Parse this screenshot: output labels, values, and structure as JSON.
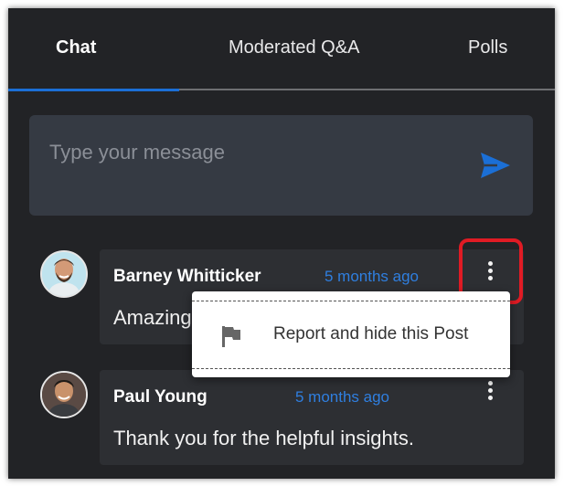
{
  "tabs": [
    {
      "label": "Chat",
      "active": true
    },
    {
      "label": "Moderated Q&A",
      "active": false
    },
    {
      "label": "Polls",
      "active": false
    }
  ],
  "composer": {
    "placeholder": "Type your message",
    "send_icon": "send-icon"
  },
  "messages": [
    {
      "author": "Barney Whitticker",
      "time": "5 months ago",
      "text": "Amazing",
      "more_icon": "more-vertical-icon"
    },
    {
      "author": "Paul Young",
      "time": "5 months ago",
      "text": "Thank you for the helpful insights.",
      "more_icon": "more-vertical-icon"
    }
  ],
  "context_menu": {
    "items": [
      {
        "label": "Report and hide this Post",
        "icon": "flag-icon"
      }
    ]
  },
  "colors": {
    "background": "#222326",
    "accent": "#1b6fd6",
    "timestamp": "#2f7fe0",
    "highlight": "#e01b24",
    "card": "#2d2f33",
    "composer": "#353a43"
  }
}
